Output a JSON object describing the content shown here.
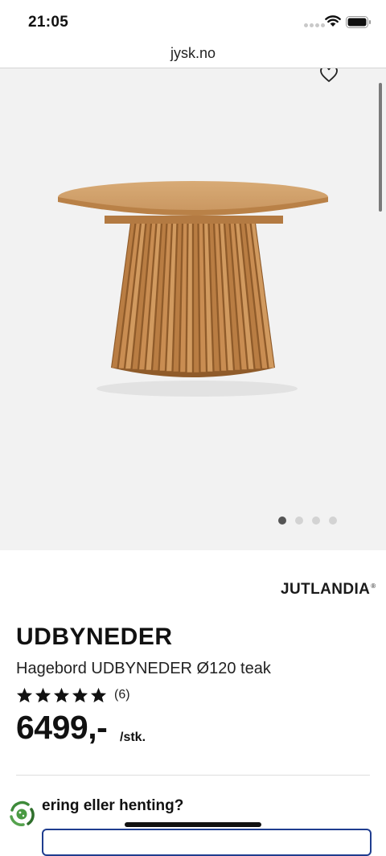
{
  "status_bar": {
    "time": "21:05"
  },
  "browser": {
    "url": "jysk.no"
  },
  "gallery": {
    "image_count": 4,
    "active_index": 0
  },
  "product": {
    "brand": "JUTLANDIA",
    "brand_mark": "®",
    "name": "UDBYNEDER",
    "description": "Hagebord UDBYNEDER Ø120 teak",
    "rating_stars": 5,
    "rating_count": "(6)",
    "price": "6499,-",
    "unit": "/stk."
  },
  "delivery": {
    "heading": "ering eller henting?"
  },
  "colors": {
    "accent": "#1f3d8f",
    "gallery_bg": "#f2f2f2",
    "wood": "#c68a4f"
  },
  "icons": [
    "wifi-icon",
    "battery-icon",
    "heart-icon",
    "star-icon",
    "cookie-settings-icon"
  ]
}
